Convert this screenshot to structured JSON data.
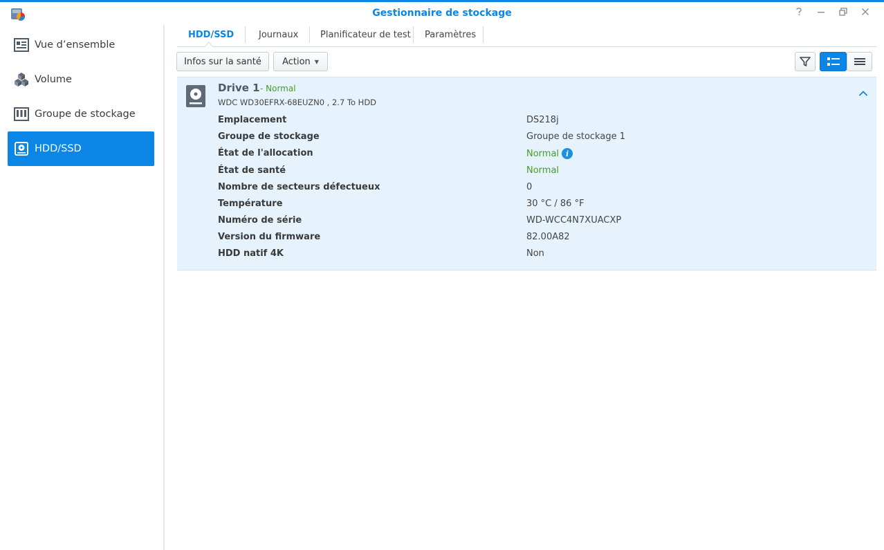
{
  "window": {
    "title": "Gestionnaire de stockage",
    "controls": [
      "help-icon",
      "minimize-icon",
      "maximize-icon",
      "close-icon"
    ]
  },
  "sidebar": {
    "items": [
      {
        "label": "Vue d’ensemble",
        "icon": "overview-icon",
        "active": false
      },
      {
        "label": "Volume",
        "icon": "volume-cubes-icon",
        "active": false
      },
      {
        "label": "Groupe de stockage",
        "icon": "storage-pool-icon",
        "active": false
      },
      {
        "label": "HDD/SSD",
        "icon": "hdd-icon",
        "active": true
      }
    ]
  },
  "tabs": [
    {
      "label": "HDD/SSD",
      "active": true
    },
    {
      "label": "Journaux",
      "active": false
    },
    {
      "label": "Planificateur de test",
      "active": false
    },
    {
      "label": "Paramètres",
      "active": false
    }
  ],
  "toolbar": {
    "health_label": "Infos sur la santé",
    "action_label": "Action",
    "filter_icon": "filter-icon",
    "view_detail_icon": "list-detail-icon",
    "view_list_icon": "list-icon"
  },
  "drive": {
    "name": "Drive 1",
    "status": "- Normal",
    "model": "WDC WD30EFRX-68EUZN0 , 2.7 To HDD",
    "details": [
      {
        "key": "Emplacement",
        "value": "DS218j"
      },
      {
        "key": "Groupe de stockage",
        "value": "Groupe de stockage 1"
      },
      {
        "key": "État de l'allocation",
        "value": "Normal"
      },
      {
        "key": "État de santé",
        "value": "Normal"
      },
      {
        "key": "Nombre de secteurs défectueux",
        "value": "0"
      },
      {
        "key": "Température",
        "value": "30 °C / 86 °F"
      },
      {
        "key": "Numéro de série",
        "value": "WD-WCC4N7XUACXP"
      },
      {
        "key": "Version du firmware",
        "value": "82.00A82"
      },
      {
        "key": "HDD natif 4K",
        "value": "Non"
      }
    ]
  },
  "colors": {
    "accent": "#0b86e6",
    "ok": "#4a9b27",
    "panel": "#e6f3fc"
  }
}
